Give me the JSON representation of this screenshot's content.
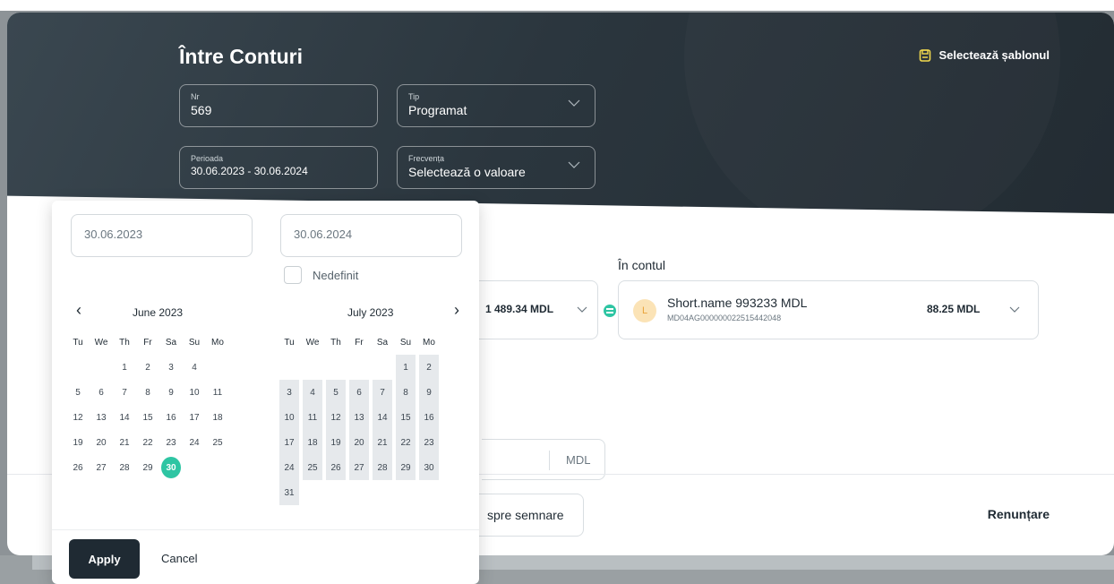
{
  "page": {
    "title": "Între Conturi",
    "template_link": "Selectează șablonul"
  },
  "form": {
    "nr": {
      "label": "Nr",
      "value": "569"
    },
    "tip": {
      "label": "Tip",
      "value": "Programat"
    },
    "perioada": {
      "label": "Perioada",
      "value": "30.06.2023 - 30.06.2024"
    },
    "frecventa": {
      "label": "Frecvența",
      "value": "Selectează o valoare"
    }
  },
  "from_account": {
    "amount": "1 489.34 MDL"
  },
  "to_account": {
    "label": "În contul",
    "avatar": "L",
    "name": "Short.name 993233 MDL",
    "iban": "MD04AG000000022515442048",
    "amount": "88.25 MDL"
  },
  "sum": {
    "currency": "MDL"
  },
  "actions": {
    "sign": "spre semnare",
    "cancel": "Renunțare"
  },
  "datepicker": {
    "start": "30.06.2023",
    "end": "30.06.2024",
    "undefined_label": "Nedefinit",
    "prev": "‹",
    "next": "›",
    "weekdays": [
      "Tu",
      "We",
      "Th",
      "Fr",
      "Sa",
      "Su",
      "Mo"
    ],
    "left_month": {
      "title": "June 2023",
      "weeks": [
        [
          "",
          "",
          "1",
          "2",
          "3",
          "4",
          ""
        ],
        [
          "5",
          "6",
          "7",
          "8",
          "9",
          "10",
          "11"
        ],
        [
          "12",
          "13",
          "14",
          "15",
          "16",
          "17",
          "18"
        ],
        [
          "19",
          "20",
          "21",
          "22",
          "23",
          "24",
          "25"
        ],
        [
          "26",
          "27",
          "28",
          "29",
          "30",
          "",
          ""
        ]
      ],
      "selected": "30"
    },
    "right_month": {
      "title": "July 2023",
      "weeks": [
        [
          "",
          "",
          "",
          "",
          "",
          "1",
          "2"
        ],
        [
          "3",
          "4",
          "5",
          "6",
          "7",
          "8",
          "9"
        ],
        [
          "10",
          "11",
          "12",
          "13",
          "14",
          "15",
          "16"
        ],
        [
          "17",
          "18",
          "19",
          "20",
          "21",
          "22",
          "23"
        ],
        [
          "24",
          "25",
          "26",
          "27",
          "28",
          "29",
          "30"
        ],
        [
          "31",
          "",
          "",
          "",
          "",
          "",
          ""
        ]
      ]
    },
    "apply": "Apply",
    "cancel": "Cancel"
  },
  "colors": {
    "accent": "#2ec5a3",
    "dark": "#1f2a33",
    "range": "#e6e9ec"
  }
}
